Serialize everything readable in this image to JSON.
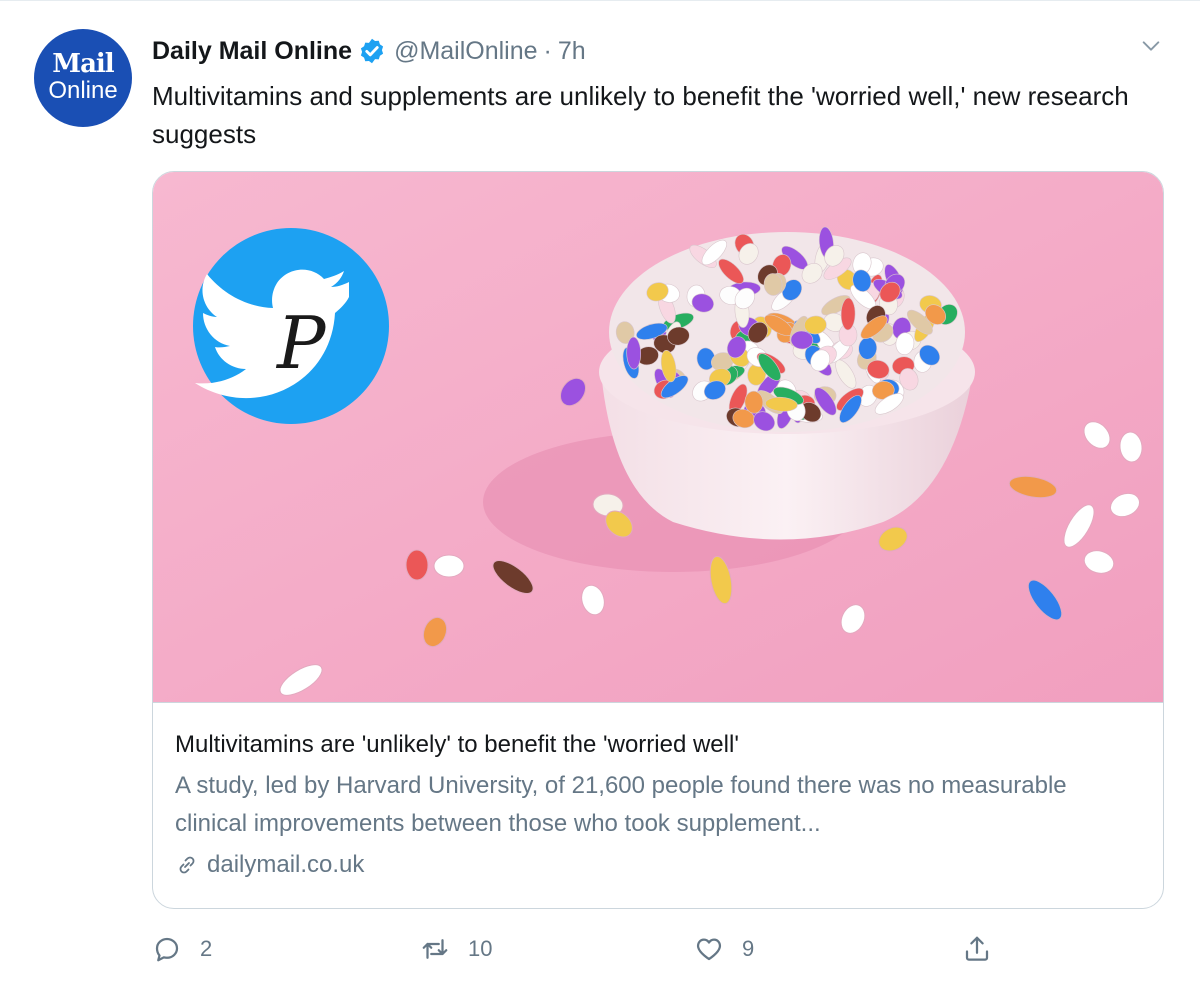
{
  "author": {
    "name": "Daily Mail Online",
    "handle": "@MailOnline",
    "separator": "·",
    "time": "7h",
    "avatar_line1": "Mail",
    "avatar_line2": "Online"
  },
  "tweet_text": "Multivitamins and supplements are unlikely to benefit the 'worried well,' new research suggests",
  "card": {
    "title": "Multivitamins are 'unlikely' to benefit the 'worried well'",
    "description": "A study, led by Harvard University, of 21,600 people found there was no measurable clinical improvements between those who took supplement...",
    "domain": "dailymail.co.uk",
    "watermark_letter": "P"
  },
  "actions": {
    "replies": "2",
    "retweets": "10",
    "likes": "9"
  },
  "colors": {
    "brand_blue": "#1da1f2",
    "avatar_blue": "#1a4fb4",
    "muted": "#657786",
    "image_pink": "#f4aec9"
  },
  "icons": [
    "verified-badge-icon",
    "chevron-down-icon",
    "link-icon",
    "reply-icon",
    "retweet-icon",
    "like-icon",
    "share-icon"
  ]
}
